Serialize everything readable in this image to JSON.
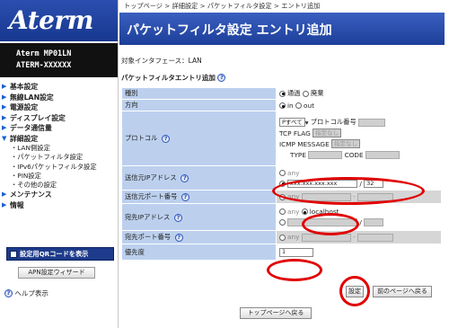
{
  "sidebar": {
    "logo": "Aterm",
    "model_line1": "Aterm  MP01LN",
    "model_line2": "ATERM-XXXXXX",
    "menu": [
      {
        "label": "基本設定"
      },
      {
        "label": "無線LAN設定"
      },
      {
        "label": "電源設定"
      },
      {
        "label": "ディスプレイ設定"
      },
      {
        "label": "データ通信量"
      },
      {
        "label": "詳細設定"
      }
    ],
    "submenu": [
      "・LAN側設定",
      "・パケットフィルタ設定",
      "・IPv6パケットフィルタ設定",
      "・PIN設定",
      "・その他の設定"
    ],
    "menu2": [
      {
        "label": "メンテナンス"
      },
      {
        "label": "情報"
      }
    ],
    "qr_button": "設定用QRコードを表示",
    "apn_button": "APN設定ウィザード",
    "help": "ヘルプ表示"
  },
  "breadcrumb": "トップページ > 詳細設定 > パケットフィルタ設定 > エントリ追加",
  "title": "パケットフィルタ設定 エントリ追加",
  "interface": "対象インタフェース：LAN",
  "section": "パケットフィルタエントリ追加",
  "form": {
    "type_label": "種別",
    "type_pass": "通過",
    "type_discard": "廃棄",
    "dir_label": "方向",
    "dir_in": "in",
    "dir_out": "out",
    "proto_label": "プロトコル",
    "proto_value": "Pすべて",
    "proto_num": "プロトコル番号",
    "tcp_flag": "TCP FLAG",
    "tcp_value": "指定なし",
    "icmp_msg": "ICMP MESSAGE",
    "icmp_value": "指定なし",
    "icmp_type": "TYPE",
    "icmp_code": "CODE",
    "src_ip_label": "送信元IPアドレス",
    "src_any": "any",
    "src_ip_ph": "xxx.xxx.xxx.xxx",
    "src_mask": "32",
    "src_port_label": "送信元ポート番号",
    "src_port_any": "any",
    "dst_ip_label": "宛先IPアドレス",
    "dst_any": "any",
    "dst_localhost": "localhost",
    "dst_port_label": "宛先ポート番号",
    "dst_port_any": "any",
    "prio_label": "優先度",
    "prio_value": "1",
    "slash": "/",
    "dash": "-"
  },
  "buttons": {
    "set": "設定",
    "back": "前のページへ戻る",
    "top": "トップページへ戻る"
  }
}
